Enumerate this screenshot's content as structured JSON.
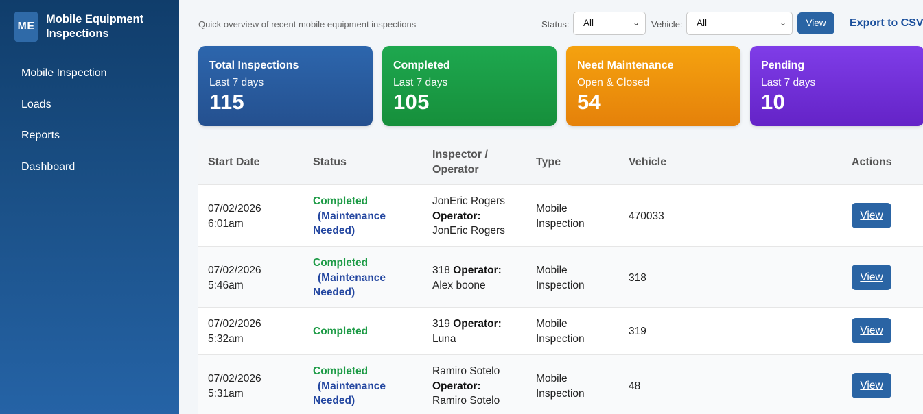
{
  "sidebar": {
    "logo": "ME",
    "title": "Mobile Equipment Inspections",
    "items": [
      {
        "label": "Mobile Inspection"
      },
      {
        "label": "Loads"
      },
      {
        "label": "Reports"
      },
      {
        "label": "Dashboard"
      }
    ]
  },
  "header": {
    "subtitle": "Quick overview of recent mobile equipment inspections",
    "status_label": "Status:",
    "status_value": "All",
    "vehicle_label": "Vehicle:",
    "vehicle_value": "All",
    "view_label": "View",
    "export_label": "Export to CSV"
  },
  "cards": [
    {
      "title": "Total Inspections",
      "sub": "Last 7 days",
      "value": "115",
      "color": "#2d66ad"
    },
    {
      "title": "Completed",
      "sub": "Last 7 days",
      "value": "105",
      "color": "#1ea84f"
    },
    {
      "title": "Need Maintenance",
      "sub": "Open & Closed",
      "value": "54",
      "color": "#f5a20f"
    },
    {
      "title": "Pending",
      "sub": "Last 7 days",
      "value": "10",
      "color": "#7f3de8"
    }
  ],
  "table": {
    "headers": {
      "start_date": "Start Date",
      "status": "Status",
      "inspector_1": "Inspector /",
      "inspector_2": "Operator",
      "type": "Type",
      "vehicle": "Vehicle",
      "actions": "Actions"
    },
    "operator_label": "Operator:",
    "rows": [
      {
        "date": "07/02/2026",
        "time": "6:01am",
        "status": "Completed",
        "maint1": "(Maintenance",
        "maint2": "Needed)",
        "inspector": "JonEric Rogers",
        "operator": "JonEric Rogers",
        "type1": "Mobile",
        "type2": "Inspection",
        "vehicle": "470033",
        "action": "View"
      },
      {
        "date": "07/02/2026",
        "time": "5:46am",
        "status": "Completed",
        "maint1": "(Maintenance",
        "maint2": "Needed)",
        "inspector": "318",
        "operator": "Alex boone",
        "type1": "Mobile",
        "type2": "Inspection",
        "vehicle": "318",
        "action": "View"
      },
      {
        "date": "07/02/2026",
        "time": "5:32am",
        "status": "Completed",
        "inspector": "319",
        "operator": "Luna",
        "type1": "Mobile",
        "type2": "Inspection",
        "vehicle": "319",
        "action": "View"
      },
      {
        "date": "07/02/2026",
        "time": "5:31am",
        "status": "Completed",
        "maint1": "(Maintenance",
        "maint2": "Needed)",
        "inspector": "Ramiro Sotelo",
        "operator": "Ramiro Sotelo",
        "type1": "Mobile",
        "type2": "Inspection",
        "vehicle": "48",
        "action": "View"
      }
    ]
  }
}
